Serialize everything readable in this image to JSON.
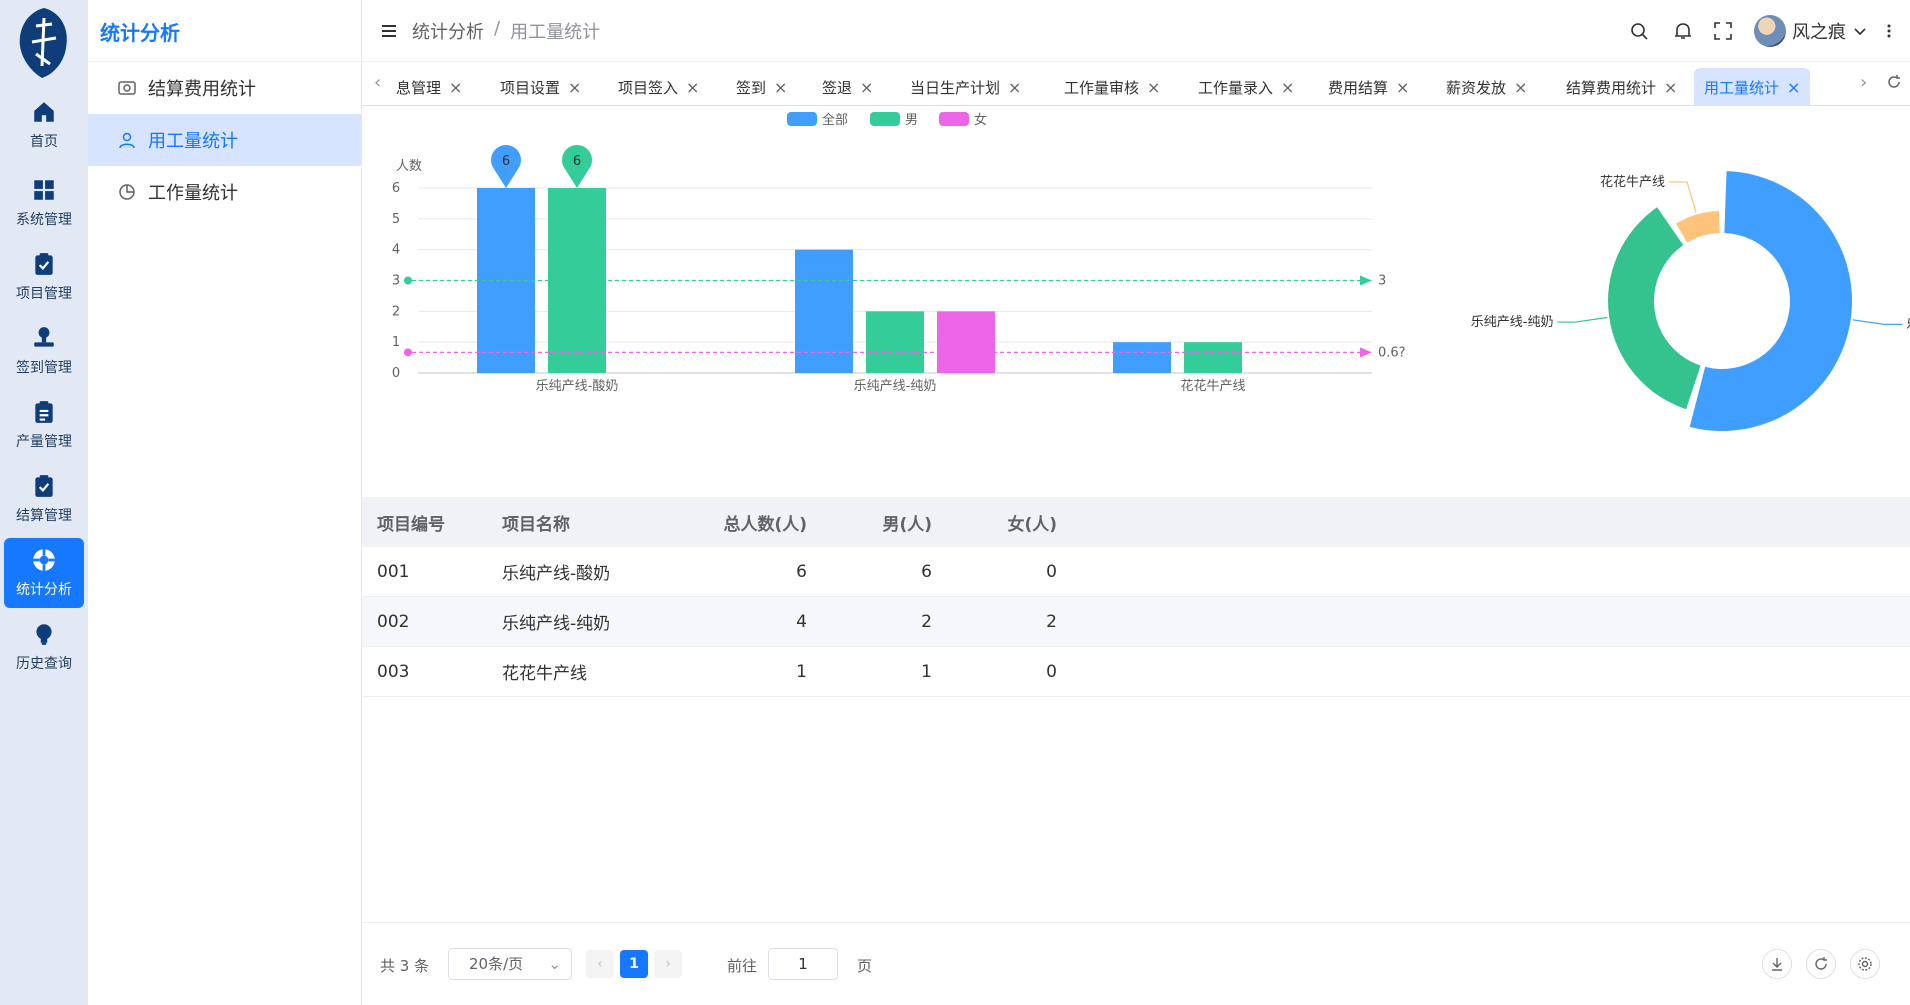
{
  "rail": {
    "items": [
      {
        "label": "首页",
        "icon": "home-icon"
      },
      {
        "label": "系统管理",
        "icon": "grid-icon"
      },
      {
        "label": "项目管理",
        "icon": "clipboard-check-icon"
      },
      {
        "label": "签到管理",
        "icon": "stamp-icon"
      },
      {
        "label": "产量管理",
        "icon": "clipboard-list-icon"
      },
      {
        "label": "结算管理",
        "icon": "clipboard-check-icon"
      },
      {
        "label": "统计分析",
        "icon": "lifebuoy-icon",
        "active": true
      },
      {
        "label": "历史查询",
        "icon": "bulb-icon"
      }
    ]
  },
  "submenu": {
    "title": "统计分析",
    "items": [
      {
        "label": "结算费用统计",
        "icon": "receipt-icon"
      },
      {
        "label": "用工量统计",
        "icon": "user-icon",
        "active": true
      },
      {
        "label": "工作量统计",
        "icon": "pie-icon"
      }
    ]
  },
  "header": {
    "breadcrumb": [
      "统计分析",
      "/",
      "用工量统计"
    ],
    "username": "风之痕"
  },
  "tabs": {
    "items": [
      "息管理",
      "项目设置",
      "项目签入",
      "签到",
      "签退",
      "当日生产计划",
      "工作量审核",
      "工作量录入",
      "费用结算",
      "薪资发放",
      "结算费用统计",
      "用工量统计"
    ],
    "active": "用工量统计"
  },
  "chart_data": [
    {
      "type": "bar",
      "ylabel": "人数",
      "ylim": [
        0,
        6
      ],
      "yticks": [
        0,
        1,
        2,
        3,
        4,
        5,
        6
      ],
      "categories": [
        "乐纯产线-酸奶",
        "乐纯产线-纯奶",
        "花花牛产线"
      ],
      "series": [
        {
          "name": "全部",
          "color": "#409eff",
          "values": [
            6,
            4,
            1
          ]
        },
        {
          "name": "男",
          "color": "#34cc99",
          "values": [
            6,
            2,
            1
          ]
        },
        {
          "name": "女",
          "color": "#ee66e8",
          "values": [
            0,
            2,
            0
          ]
        }
      ],
      "max_markers": [
        {
          "series": "全部",
          "value": "6"
        },
        {
          "series": "男",
          "value": "6"
        }
      ],
      "mean_lines": [
        {
          "series": "男",
          "value": 3,
          "label": "3",
          "color": "#34cc99"
        },
        {
          "series": "女",
          "value": 0.67,
          "label": "0.6?",
          "color": "#ee66e8"
        }
      ],
      "legend_position": "top-center"
    },
    {
      "type": "pie",
      "style": "donut",
      "slices": [
        {
          "label": "乐纯产线-...",
          "value": 6,
          "color": "#409eff"
        },
        {
          "label": "乐纯产线-纯奶",
          "value": 4,
          "color": "#34c38f"
        },
        {
          "label": "花花牛产线",
          "value": 1,
          "color": "#fdc37a"
        }
      ]
    }
  ],
  "table": {
    "headers": [
      "项目编号",
      "项目名称",
      "总人数(人)",
      "男(人)",
      "女(人)"
    ],
    "rows": [
      [
        "001",
        "乐纯产线-酸奶",
        "6",
        "6",
        "0"
      ],
      [
        "002",
        "乐纯产线-纯奶",
        "4",
        "2",
        "2"
      ],
      [
        "003",
        "花花牛产线",
        "1",
        "1",
        "0"
      ]
    ]
  },
  "pagination": {
    "total": "共 3 条",
    "page_size": "20条/页",
    "current": "1",
    "goto_label": "前往",
    "goto_value": "1",
    "page_label": "页"
  }
}
